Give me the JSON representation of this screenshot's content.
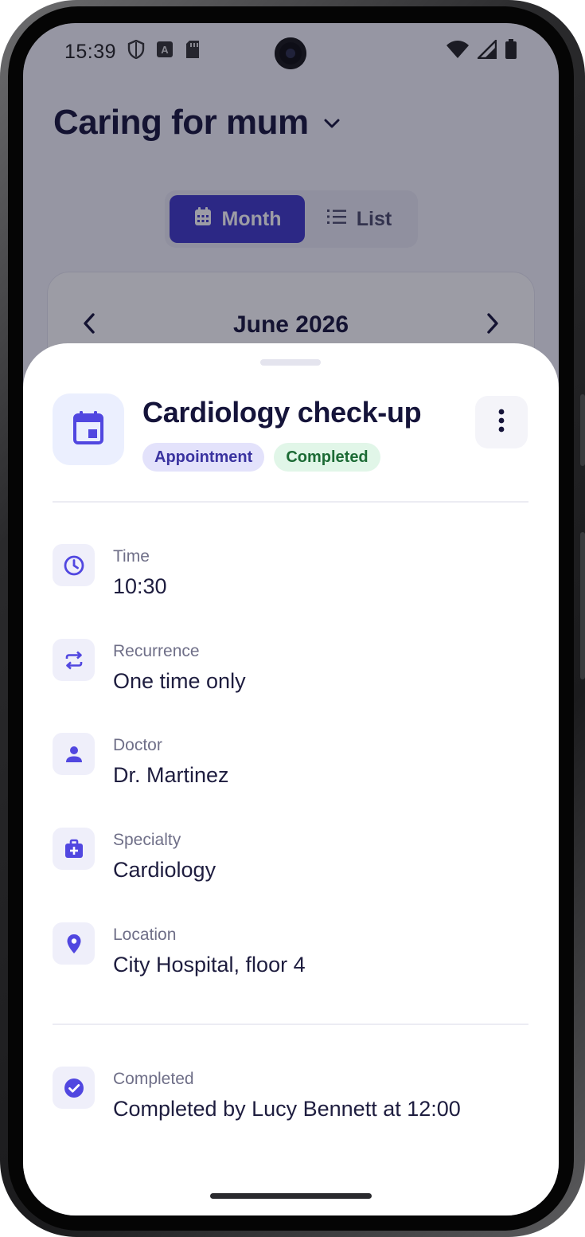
{
  "status_bar": {
    "time": "15:39",
    "icons_left": [
      "shield-icon",
      "keyboard-a-icon",
      "sd-card-icon"
    ],
    "icons_right": [
      "wifi-icon",
      "signal-icon",
      "battery-icon"
    ]
  },
  "header": {
    "title": "Caring for mum",
    "dropdown_icon": "chevron-down-icon"
  },
  "view_toggle": {
    "month_label": "Month",
    "list_label": "List",
    "selected": "Month"
  },
  "calendar": {
    "month_label": "June 2026"
  },
  "sheet": {
    "title": "Cardiology check-up",
    "header_icon": "calendar-icon",
    "chips": {
      "type": "Appointment",
      "status": "Completed"
    },
    "details": [
      {
        "icon": "clock-icon",
        "label": "Time",
        "value": "10:30"
      },
      {
        "icon": "repeat-icon",
        "label": "Recurrence",
        "value": "One time only"
      },
      {
        "icon": "person-icon",
        "label": "Doctor",
        "value": "Dr. Martinez"
      },
      {
        "icon": "medical-bag-icon",
        "label": "Specialty",
        "value": "Cardiology"
      },
      {
        "icon": "location-pin-icon",
        "label": "Location",
        "value": "City Hospital, floor 4"
      }
    ],
    "completion": {
      "icon": "check-circle-icon",
      "label": "Completed",
      "value": "Completed by Lucy Bennett at 12:00"
    }
  },
  "colors": {
    "accent": "#3f38c8",
    "icon_accent": "#5147e0",
    "title_text": "#15143a",
    "chip_type_bg": "#e3e2fb",
    "chip_status_bg": "#e1f6e8",
    "chip_status_text": "#1c6b35"
  }
}
